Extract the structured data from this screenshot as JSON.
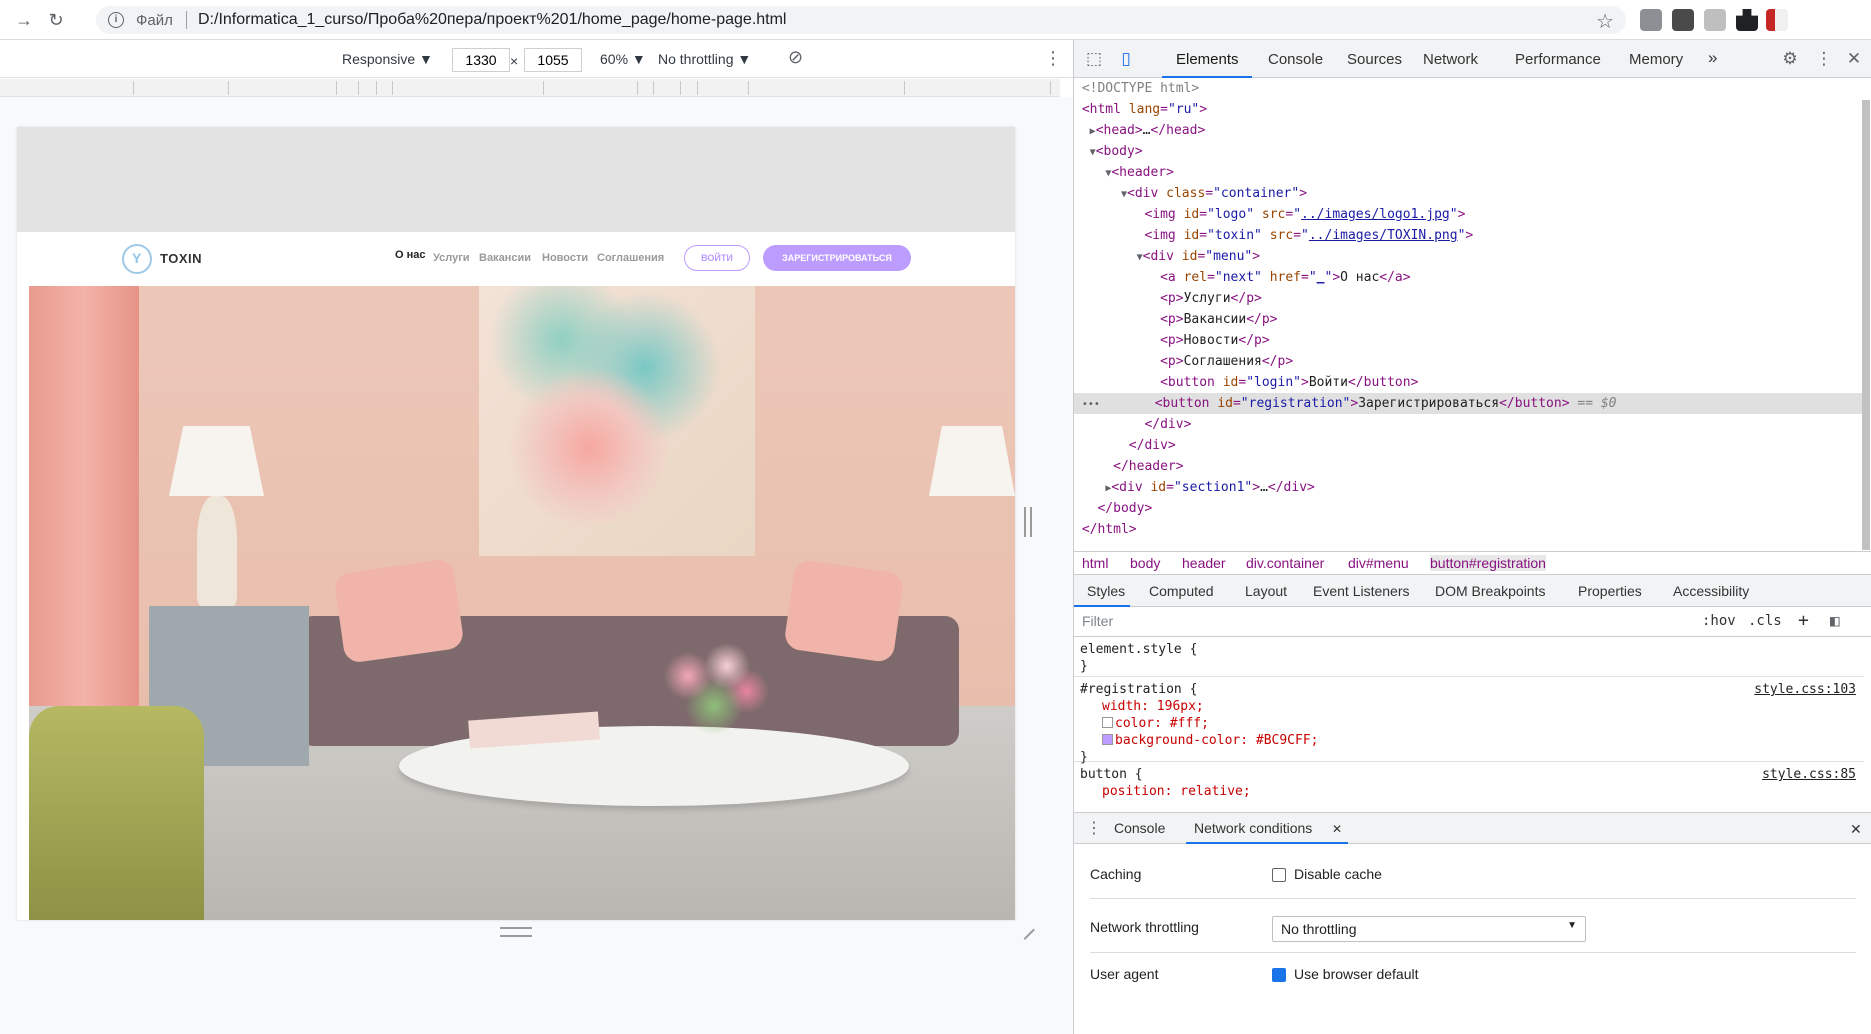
{
  "browser": {
    "scheme_label": "Файл",
    "url": "D:/Informatica_1_curso/Проба%20пера/проект%201/home_page/home-page.html"
  },
  "device_toolbar": {
    "device": "Responsive ▼",
    "width": "1330",
    "times": "×",
    "height": "1055",
    "zoom": "60% ▼",
    "throttling": "No throttling ▼"
  },
  "site": {
    "brand": "TOXIN",
    "menu": [
      "О нас",
      "Услуги",
      "Вакансии",
      "Новости",
      "Соглашения"
    ],
    "login_label": "ВОЙТИ",
    "register_label": "ЗАРЕГИСТРИРОВАТЬСЯ",
    "accent_color": "#BC9CFF"
  },
  "devtools": {
    "tabs": [
      "Elements",
      "Console",
      "Sources",
      "Network",
      "Performance",
      "Memory",
      "»"
    ],
    "breadcrumbs": [
      "html",
      "body",
      "header",
      "div.container",
      "div#menu",
      "button#registration"
    ],
    "style_tabs": [
      "Styles",
      "Computed",
      "Layout",
      "Event Listeners",
      "DOM Breakpoints",
      "Properties",
      "Accessibility"
    ],
    "filter_placeholder": "Filter",
    "filter_buttons": [
      ":hov",
      ".cls",
      "+"
    ],
    "rules": [
      {
        "selector": "element.style {",
        "close": "}",
        "source": "",
        "props": []
      },
      {
        "selector": "#registration {",
        "close": "}",
        "source": "style.css:103",
        "props": [
          "width: 196px;",
          "color: #fff;",
          "background-color: #BC9CFF;"
        ]
      },
      {
        "selector": "button {",
        "close": "",
        "source": "style.css:85",
        "props": [
          "position: relative;"
        ]
      }
    ],
    "drawer_tabs": [
      "Console",
      "Network conditions"
    ],
    "network_conditions": {
      "caching_label": "Caching",
      "disable_cache_label": "Disable cache",
      "throttling_label": "Network throttling",
      "throttling_value": "No throttling",
      "user_agent_label": "User agent",
      "use_default_label": "Use browser default"
    }
  }
}
